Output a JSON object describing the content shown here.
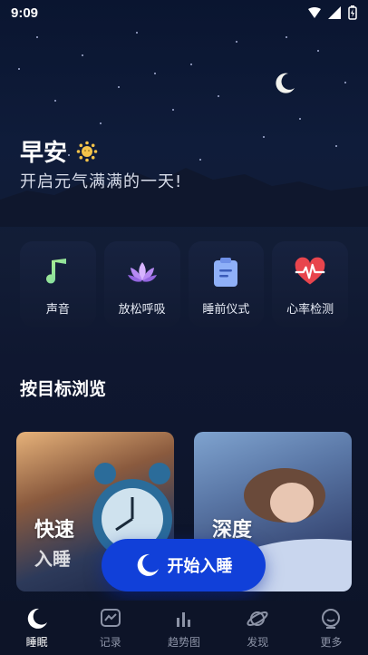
{
  "status": {
    "time": "9:09"
  },
  "greeting": {
    "title": "早安",
    "subtitle": "开启元气满满的一天!"
  },
  "quick_actions": [
    {
      "label": "声音",
      "icon": "music-note-icon"
    },
    {
      "label": "放松呼吸",
      "icon": "lotus-icon"
    },
    {
      "label": "睡前仪式",
      "icon": "clipboard-icon"
    },
    {
      "label": "心率检测",
      "icon": "heart-rate-icon"
    }
  ],
  "section": {
    "title": "按目标浏览"
  },
  "goal_cards": [
    {
      "line1": "快速",
      "line2": "入睡"
    },
    {
      "line1": "深度",
      "line2": ""
    }
  ],
  "start_button": {
    "label": "开始入睡"
  },
  "bottom_nav": [
    {
      "label": "睡眠",
      "icon": "moon-icon",
      "active": true
    },
    {
      "label": "记录",
      "icon": "record-icon",
      "active": false
    },
    {
      "label": "趋势图",
      "icon": "bar-chart-icon",
      "active": false
    },
    {
      "label": "发现",
      "icon": "planet-icon",
      "active": false
    },
    {
      "label": "更多",
      "icon": "more-icon",
      "active": false
    }
  ],
  "colors": {
    "accent": "#1140d9",
    "background": "#0b1224",
    "card": "#141e38"
  }
}
